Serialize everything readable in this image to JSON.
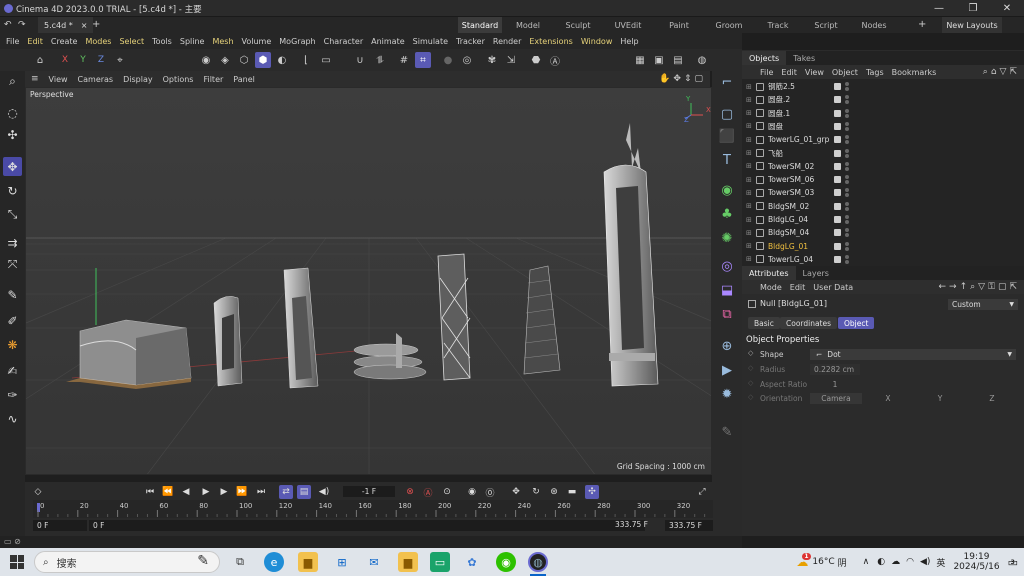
{
  "window": {
    "title": "Cinema 4D 2023.0.0 TRIAL - [5.c4d *] - 主要",
    "controls": [
      "—",
      "❐",
      "✕"
    ]
  },
  "tabs": {
    "document": "5.c4d *",
    "close": "×",
    "add": "+",
    "layouts": [
      "Standard",
      "Model",
      "Sculpt",
      "UVEdit",
      "Paint",
      "Groom",
      "Track",
      "Script",
      "Nodes"
    ],
    "layouts_add": "+",
    "new_layouts": "New Layouts"
  },
  "menu": [
    "File",
    "Edit",
    "Create",
    "Modes",
    "Select",
    "Tools",
    "Spline",
    "Mesh",
    "Volume",
    "MoGraph",
    "Character",
    "Animate",
    "Simulate",
    "Tracker",
    "Render",
    "Extensions",
    "Window",
    "Help"
  ],
  "menu_highlight": [
    "Modes",
    "Select",
    "Mesh",
    "Extensions",
    "Window"
  ],
  "toolbar": {
    "axes": [
      "X",
      "Y",
      "Z"
    ]
  },
  "viewport": {
    "menu": [
      "View",
      "Cameras",
      "Display",
      "Options",
      "Filter",
      "Panel"
    ],
    "label": "Perspective",
    "grid_spacing": "Grid Spacing : 1000 cm",
    "axis_labels": [
      "Y",
      "X",
      "Z"
    ]
  },
  "objects_panel": {
    "tabs": [
      "Objects",
      "Takes"
    ],
    "menu": [
      "File",
      "Edit",
      "View",
      "Object",
      "Tags",
      "Bookmarks"
    ],
    "items": [
      {
        "name": "钢筋2.5",
        "selected": false
      },
      {
        "name": "圆盘.2",
        "selected": false
      },
      {
        "name": "圆盘.1",
        "selected": false
      },
      {
        "name": "圆盘",
        "selected": false
      },
      {
        "name": "TowerLG_01_grp",
        "selected": false
      },
      {
        "name": "飞船",
        "selected": false
      },
      {
        "name": "TowerSM_02",
        "selected": false
      },
      {
        "name": "TowerSM_06",
        "selected": false
      },
      {
        "name": "TowerSM_03",
        "selected": false
      },
      {
        "name": "BldgSM_02",
        "selected": false
      },
      {
        "name": "BldgLG_04",
        "selected": false
      },
      {
        "name": "BldgSM_04",
        "selected": false
      },
      {
        "name": "BldgLG_01",
        "selected": true
      },
      {
        "name": "TowerLG_04",
        "selected": false
      }
    ]
  },
  "attributes_panel": {
    "tabs": [
      "Attributes",
      "Layers"
    ],
    "menu": [
      "Mode",
      "Edit",
      "User Data"
    ],
    "object_name": "Null [BldgLG_01]",
    "preset": "Custom",
    "subtabs": [
      "Basic",
      "Coordinates",
      "Object"
    ],
    "section": "Object Properties",
    "props": {
      "shape_label": "Shape",
      "shape_value": "Dot",
      "radius_label": "Radius",
      "radius_value": "0.2282 cm",
      "aspect_label": "Aspect Ratio",
      "aspect_value": "1",
      "orientation_label": "Orientation",
      "orientation_value": "Camera",
      "orientation_axes": [
        "X",
        "Y",
        "Z"
      ]
    }
  },
  "timeline": {
    "current_frame": "-1 F",
    "ticks": [
      "0",
      "20",
      "40",
      "60",
      "80",
      "100",
      "120",
      "140",
      "160",
      "180",
      "200",
      "220",
      "240",
      "260",
      "280",
      "300",
      "320"
    ],
    "start": "0 F",
    "start2": "0 F",
    "end": "333.75 F",
    "end2": "333.75 F"
  },
  "taskbar": {
    "search_placeholder": "搜索",
    "weather_temp": "16°C",
    "weather_desc": "阴",
    "ime": "英",
    "time": "19:19",
    "date": "2024/5/16",
    "notification_count": "3",
    "weather_badge": "1"
  },
  "colors": {
    "accent": "#5a5ab4",
    "selected_object": "#f0c040",
    "viewport_bg": "#3c3c3c"
  }
}
